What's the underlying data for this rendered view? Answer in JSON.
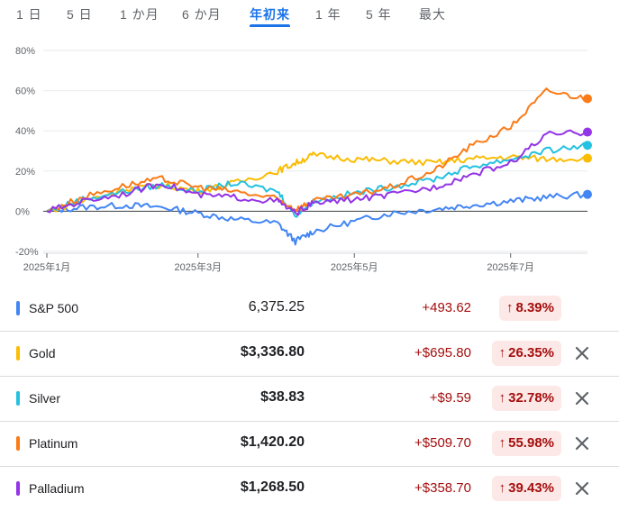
{
  "tabs": [
    {
      "label": "1 日",
      "active": false
    },
    {
      "label": "5 日",
      "active": false
    },
    {
      "label": "1 か月",
      "active": false
    },
    {
      "label": "6 か月",
      "active": false
    },
    {
      "label": "年初来",
      "active": true
    },
    {
      "label": "1 年",
      "active": false
    },
    {
      "label": "5 年",
      "active": false
    },
    {
      "label": "最大",
      "active": false
    }
  ],
  "chart_data": {
    "type": "line",
    "yticks": [
      "80%",
      "60%",
      "40%",
      "20%",
      "0%",
      "-20%"
    ],
    "ylim": [
      -20,
      80
    ],
    "xticks": [
      "2025年1月",
      "2025年3月",
      "2025年5月",
      "2025年7月"
    ],
    "x_dates": [
      "2025-01-01",
      "2025-01-15",
      "2025-02-01",
      "2025-02-15",
      "2025-03-01",
      "2025-03-15",
      "2025-04-01",
      "2025-04-08",
      "2025-04-15",
      "2025-05-01",
      "2025-05-15",
      "2025-06-01",
      "2025-06-15",
      "2025-07-01",
      "2025-07-15",
      "2025-07-31"
    ],
    "grid": true,
    "series": [
      {
        "name": "S&P 500",
        "color": "#4285f4",
        "values": [
          0,
          2,
          3,
          2,
          -1,
          -4,
          -6,
          -15,
          -10,
          -5,
          -1,
          1,
          3,
          5,
          7,
          8.4
        ]
      },
      {
        "name": "Gold",
        "color": "#fbbc04",
        "values": [
          0,
          5,
          11,
          13,
          10,
          14,
          20,
          24,
          28,
          26,
          25,
          24,
          26,
          27,
          26,
          26.4
        ]
      },
      {
        "name": "Silver",
        "color": "#24c1e0",
        "values": [
          0,
          6,
          10,
          13,
          10,
          14,
          10,
          -2,
          5,
          9,
          12,
          16,
          22,
          26,
          30,
          32.8
        ]
      },
      {
        "name": "Platinum",
        "color": "#fa7b17",
        "values": [
          0,
          7,
          13,
          16,
          12,
          10,
          6,
          1,
          5,
          8,
          12,
          20,
          32,
          42,
          60,
          56
        ]
      },
      {
        "name": "Palladium",
        "color": "#9334e6",
        "values": [
          0,
          5,
          9,
          14,
          8,
          7,
          5,
          -1,
          4,
          6,
          8,
          12,
          18,
          24,
          38,
          39.4
        ]
      }
    ]
  },
  "rows": [
    {
      "name": "S&P 500",
      "color": "#4285f4",
      "price": "6,375.25",
      "change": "+493.62",
      "pct": "8.39%",
      "closable": false
    },
    {
      "name": "Gold",
      "color": "#fbbc04",
      "price": "$3,336.80",
      "change": "+$695.80",
      "pct": "26.35%",
      "closable": true
    },
    {
      "name": "Silver",
      "color": "#24c1e0",
      "price": "$38.83",
      "change": "+$9.59",
      "pct": "32.78%",
      "closable": true
    },
    {
      "name": "Platinum",
      "color": "#fa7b17",
      "price": "$1,420.20",
      "change": "+$509.70",
      "pct": "55.98%",
      "closable": true
    },
    {
      "name": "Palladium",
      "color": "#9334e6",
      "price": "$1,268.50",
      "change": "+$358.70",
      "pct": "39.43%",
      "closable": true
    }
  ],
  "icons": {
    "arrow": "arrow-up-icon",
    "close": "close-icon"
  }
}
